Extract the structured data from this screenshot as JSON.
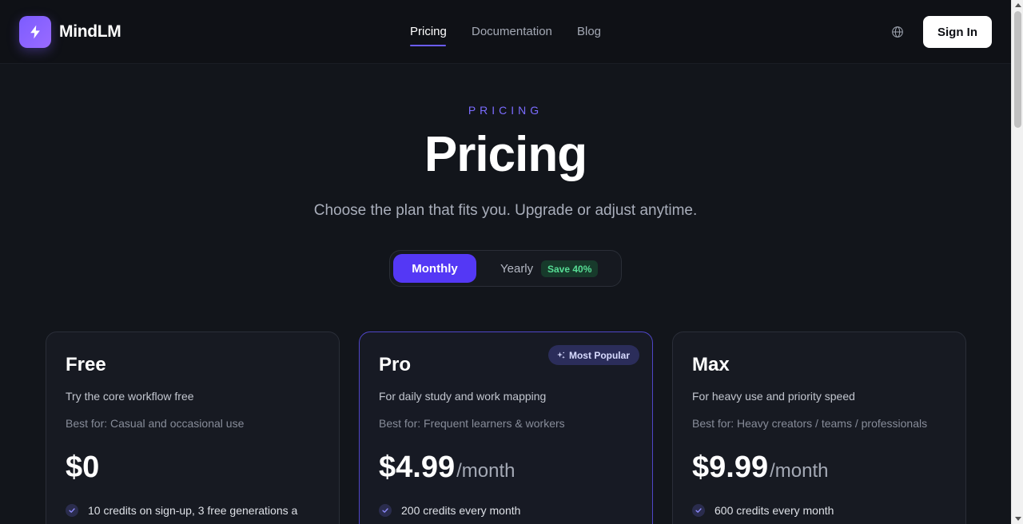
{
  "header": {
    "brand": "MindLM",
    "nav": [
      "Pricing",
      "Documentation",
      "Blog"
    ],
    "active_nav": "Pricing",
    "sign_in": "Sign In",
    "icons": [
      "lightning-bolt-icon",
      "globe-icon"
    ]
  },
  "hero": {
    "eyebrow": "PRICING",
    "title": "Pricing",
    "subtitle": "Choose the plan that fits you. Upgrade or adjust anytime."
  },
  "billing_toggle": {
    "monthly": "Monthly",
    "yearly": "Yearly",
    "save_badge": "Save 40%",
    "selected": "Monthly"
  },
  "plans": [
    {
      "name": "Free",
      "tagline": "Try the core workflow free",
      "best_for": "Best for: Casual and occasional use",
      "price": "$0",
      "period": "",
      "features": [
        "10 credits on sign-up, 3 free generations a"
      ]
    },
    {
      "name": "Pro",
      "tagline": "For daily study and work mapping",
      "best_for": "Best for: Frequent learners & workers",
      "price": "$4.99",
      "period": "/month",
      "badge": "Most Popular",
      "features": [
        "200 credits every month"
      ]
    },
    {
      "name": "Max",
      "tagline": "For heavy use and priority speed",
      "best_for": "Best for: Heavy creators / teams / professionals",
      "price": "$9.99",
      "period": "/month",
      "features": [
        "600 credits every month"
      ]
    }
  ],
  "colors": {
    "accent": "#5438f5",
    "eyebrow": "#7b6cff",
    "background": "#12151b",
    "save_green": "#57dd95"
  }
}
